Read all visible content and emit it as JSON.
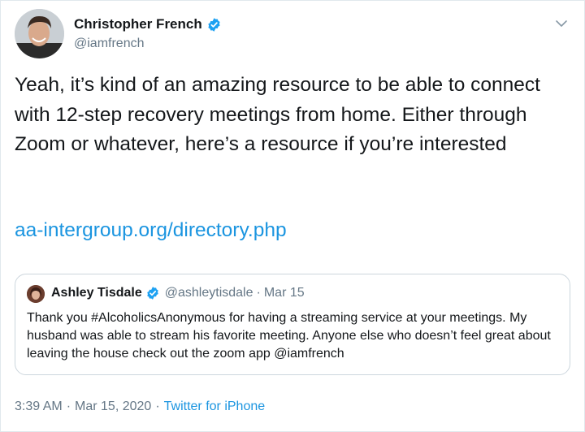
{
  "author": {
    "name": "Christopher French",
    "handle": "@iamfrench",
    "verified": true
  },
  "tweet": {
    "text": "Yeah, it’s kind of an amazing resource to be able to connect with 12-step recovery meetings from home. Either through Zoom or whatever, here’s a resource if you’re interested",
    "link": "aa-intergroup.org/directory.php"
  },
  "quote": {
    "name": "Ashley Tisdale",
    "handle": "@ashleytisdale",
    "separator": "·",
    "date": "Mar 15",
    "text": "Thank you #AlcoholicsAnonymous for having a streaming service at your meetings. My husband was able to stream his favorite meeting. Anyone else who doesn’t feel great about leaving the house check out the zoom app @iamfrench"
  },
  "meta": {
    "time": "3:39 AM",
    "separator1": "·",
    "date": "Mar 15, 2020",
    "separator2": "·",
    "source": "Twitter for iPhone"
  },
  "colors": {
    "link": "#1b95e0",
    "text": "#14171a",
    "secondary": "#657786",
    "verified": "#1da1f2",
    "border": "#ccd6dd"
  },
  "icons": {
    "verified": "verified-badge-icon",
    "menu": "chevron-down-icon"
  }
}
